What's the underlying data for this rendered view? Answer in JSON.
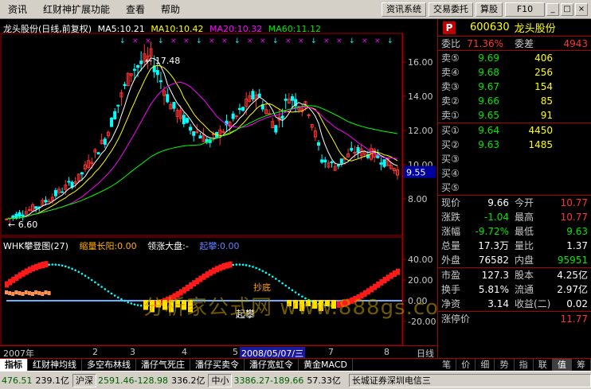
{
  "menubar": {
    "items": [
      "资讯",
      "红财神扩展功能",
      "查看",
      "帮助"
    ],
    "buttons": [
      "资讯系统",
      "交易委托",
      "算股",
      "F10"
    ],
    "window_buttons": [
      "_",
      "□",
      "×"
    ]
  },
  "main_chart": {
    "stock_title": "龙头股份(日线,前复权)",
    "ma5": "MA5:10.21",
    "ma10": "MA10:10.42",
    "ma20": "MA20:10.32",
    "ma60": "MA60:11.12",
    "high_label": "17.48",
    "low_label": "6.60",
    "price_tag": "9.55",
    "y_ticks": [
      "16.00",
      "14.00",
      "12.00",
      "10.00",
      "8.00"
    ]
  },
  "indicator": {
    "title": "WHK攀登图(27)",
    "f1": "缩量长阳:0.00",
    "f2": "领涨大盘:-",
    "f3": "起攀:0.00",
    "y_ticks": [
      "40.00",
      "20.00",
      "0.00",
      "-20.00"
    ],
    "label_qipan": "起攀",
    "label_chaodi": "抄底",
    "watermark": "分析家公式网 www.888gs.com"
  },
  "date_axis": {
    "labels": [
      "2007年",
      "2",
      "3",
      "4",
      "5",
      "7",
      "8"
    ],
    "highlight": "2008/05/07/三",
    "right_label": "日线"
  },
  "quote_panel": {
    "code": "600630",
    "name": "龙头股份",
    "weibi_label": "委比",
    "weibi_value": "71.36%",
    "weicha_label": "委差",
    "weicha_value": "4943",
    "sells": [
      {
        "label": "卖⑤",
        "price": "9.69",
        "vol": "406"
      },
      {
        "label": "卖④",
        "price": "9.68",
        "vol": "256"
      },
      {
        "label": "卖③",
        "price": "9.67",
        "vol": "154"
      },
      {
        "label": "卖②",
        "price": "9.66",
        "vol": "85"
      },
      {
        "label": "卖①",
        "price": "9.65",
        "vol": "91"
      }
    ],
    "buys": [
      {
        "label": "买①",
        "price": "9.64",
        "vol": "4450"
      },
      {
        "label": "买②",
        "price": "9.63",
        "vol": "1485"
      },
      {
        "label": "买③",
        "price": "",
        "vol": ""
      },
      {
        "label": "买④",
        "price": "",
        "vol": ""
      },
      {
        "label": "买⑤",
        "price": "",
        "vol": ""
      }
    ],
    "stats": [
      {
        "l1": "现价",
        "v1": "9.66",
        "l2": "今开",
        "v2": "10.77"
      },
      {
        "l1": "涨跌",
        "v1": "-1.04",
        "l2": "最高",
        "v2": "10.77"
      },
      {
        "l1": "涨幅",
        "v1": "-9.72%",
        "l2": "最低",
        "v2": "9.63"
      },
      {
        "l1": "总量",
        "v1": "17.3万",
        "l2": "量比",
        "v2": "1.37"
      },
      {
        "l1": "外盘",
        "v1": "76582",
        "l2": "内盘",
        "v2": "95951"
      }
    ],
    "stats2": [
      {
        "l1": "市盈",
        "v1": "127.3",
        "l2": "股本",
        "v2": "4.25亿"
      },
      {
        "l1": "换手",
        "v1": "5.81%",
        "l2": "流通",
        "v2": "2.97亿"
      },
      {
        "l1": "净资",
        "v1": "3.14",
        "l2": "收益(二)",
        "v2": "0.02"
      }
    ],
    "limit_label": "涨停价",
    "limit_value": "11.77"
  },
  "right_tabs": [
    "笔",
    "价",
    "细",
    "势",
    "指",
    "联",
    "值",
    "筹"
  ],
  "indicator_tabs": [
    "指标",
    "红财神均线",
    "多空布林线",
    "潘仔气死庄",
    "潘仔买卖令",
    "潘仔宽虹令",
    "黄金MACD"
  ],
  "statusbar": {
    "idx1_name": "476.51",
    "idx1_val": "239.1亿",
    "idx2_name": "沪深",
    "idx2_val": "2591.46-128.98",
    "idx2_amt": "336.2亿",
    "idx3_name": "中小",
    "idx3_val": "3386.27-189.66",
    "idx3_amt": "57.33亿",
    "broker": "长城证券深圳电信三"
  },
  "colors": {
    "up": "#ff3232",
    "down": "#00e600",
    "ma5": "#ffffff",
    "ma10": "#ffff00",
    "ma20": "#ff00ff",
    "ma60": "#00ff00",
    "grid": "#a00000"
  }
}
